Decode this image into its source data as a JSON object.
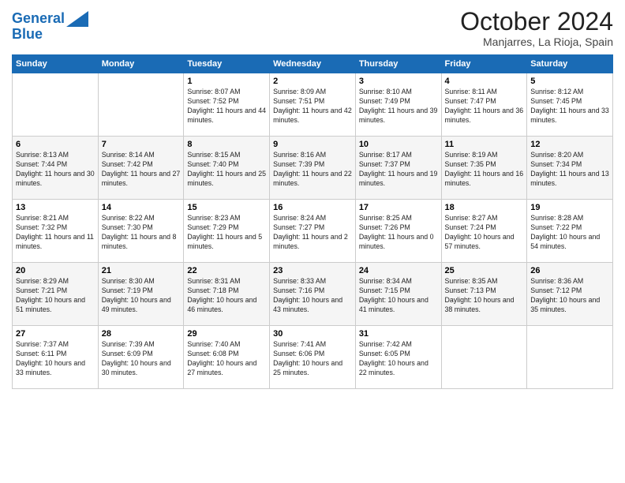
{
  "header": {
    "logo_line1": "General",
    "logo_line2": "Blue",
    "month_title": "October 2024",
    "location": "Manjarres, La Rioja, Spain"
  },
  "days_of_week": [
    "Sunday",
    "Monday",
    "Tuesday",
    "Wednesday",
    "Thursday",
    "Friday",
    "Saturday"
  ],
  "weeks": [
    [
      {
        "day": "",
        "info": ""
      },
      {
        "day": "",
        "info": ""
      },
      {
        "day": "1",
        "info": "Sunrise: 8:07 AM\nSunset: 7:52 PM\nDaylight: 11 hours and 44 minutes."
      },
      {
        "day": "2",
        "info": "Sunrise: 8:09 AM\nSunset: 7:51 PM\nDaylight: 11 hours and 42 minutes."
      },
      {
        "day": "3",
        "info": "Sunrise: 8:10 AM\nSunset: 7:49 PM\nDaylight: 11 hours and 39 minutes."
      },
      {
        "day": "4",
        "info": "Sunrise: 8:11 AM\nSunset: 7:47 PM\nDaylight: 11 hours and 36 minutes."
      },
      {
        "day": "5",
        "info": "Sunrise: 8:12 AM\nSunset: 7:45 PM\nDaylight: 11 hours and 33 minutes."
      }
    ],
    [
      {
        "day": "6",
        "info": "Sunrise: 8:13 AM\nSunset: 7:44 PM\nDaylight: 11 hours and 30 minutes."
      },
      {
        "day": "7",
        "info": "Sunrise: 8:14 AM\nSunset: 7:42 PM\nDaylight: 11 hours and 27 minutes."
      },
      {
        "day": "8",
        "info": "Sunrise: 8:15 AM\nSunset: 7:40 PM\nDaylight: 11 hours and 25 minutes."
      },
      {
        "day": "9",
        "info": "Sunrise: 8:16 AM\nSunset: 7:39 PM\nDaylight: 11 hours and 22 minutes."
      },
      {
        "day": "10",
        "info": "Sunrise: 8:17 AM\nSunset: 7:37 PM\nDaylight: 11 hours and 19 minutes."
      },
      {
        "day": "11",
        "info": "Sunrise: 8:19 AM\nSunset: 7:35 PM\nDaylight: 11 hours and 16 minutes."
      },
      {
        "day": "12",
        "info": "Sunrise: 8:20 AM\nSunset: 7:34 PM\nDaylight: 11 hours and 13 minutes."
      }
    ],
    [
      {
        "day": "13",
        "info": "Sunrise: 8:21 AM\nSunset: 7:32 PM\nDaylight: 11 hours and 11 minutes."
      },
      {
        "day": "14",
        "info": "Sunrise: 8:22 AM\nSunset: 7:30 PM\nDaylight: 11 hours and 8 minutes."
      },
      {
        "day": "15",
        "info": "Sunrise: 8:23 AM\nSunset: 7:29 PM\nDaylight: 11 hours and 5 minutes."
      },
      {
        "day": "16",
        "info": "Sunrise: 8:24 AM\nSunset: 7:27 PM\nDaylight: 11 hours and 2 minutes."
      },
      {
        "day": "17",
        "info": "Sunrise: 8:25 AM\nSunset: 7:26 PM\nDaylight: 11 hours and 0 minutes."
      },
      {
        "day": "18",
        "info": "Sunrise: 8:27 AM\nSunset: 7:24 PM\nDaylight: 10 hours and 57 minutes."
      },
      {
        "day": "19",
        "info": "Sunrise: 8:28 AM\nSunset: 7:22 PM\nDaylight: 10 hours and 54 minutes."
      }
    ],
    [
      {
        "day": "20",
        "info": "Sunrise: 8:29 AM\nSunset: 7:21 PM\nDaylight: 10 hours and 51 minutes."
      },
      {
        "day": "21",
        "info": "Sunrise: 8:30 AM\nSunset: 7:19 PM\nDaylight: 10 hours and 49 minutes."
      },
      {
        "day": "22",
        "info": "Sunrise: 8:31 AM\nSunset: 7:18 PM\nDaylight: 10 hours and 46 minutes."
      },
      {
        "day": "23",
        "info": "Sunrise: 8:33 AM\nSunset: 7:16 PM\nDaylight: 10 hours and 43 minutes."
      },
      {
        "day": "24",
        "info": "Sunrise: 8:34 AM\nSunset: 7:15 PM\nDaylight: 10 hours and 41 minutes."
      },
      {
        "day": "25",
        "info": "Sunrise: 8:35 AM\nSunset: 7:13 PM\nDaylight: 10 hours and 38 minutes."
      },
      {
        "day": "26",
        "info": "Sunrise: 8:36 AM\nSunset: 7:12 PM\nDaylight: 10 hours and 35 minutes."
      }
    ],
    [
      {
        "day": "27",
        "info": "Sunrise: 7:37 AM\nSunset: 6:11 PM\nDaylight: 10 hours and 33 minutes."
      },
      {
        "day": "28",
        "info": "Sunrise: 7:39 AM\nSunset: 6:09 PM\nDaylight: 10 hours and 30 minutes."
      },
      {
        "day": "29",
        "info": "Sunrise: 7:40 AM\nSunset: 6:08 PM\nDaylight: 10 hours and 27 minutes."
      },
      {
        "day": "30",
        "info": "Sunrise: 7:41 AM\nSunset: 6:06 PM\nDaylight: 10 hours and 25 minutes."
      },
      {
        "day": "31",
        "info": "Sunrise: 7:42 AM\nSunset: 6:05 PM\nDaylight: 10 hours and 22 minutes."
      },
      {
        "day": "",
        "info": ""
      },
      {
        "day": "",
        "info": ""
      }
    ]
  ]
}
